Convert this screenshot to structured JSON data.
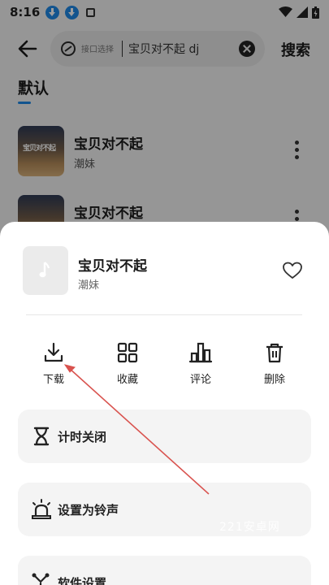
{
  "status_bar": {
    "time": "8:16"
  },
  "header": {
    "source_label": "接口选择",
    "search_query": "宝贝对不起 dj",
    "search_button": "搜索"
  },
  "tab": {
    "label": "默认"
  },
  "songs": [
    {
      "title": "宝贝对不起",
      "artist": "潮妹",
      "cover_text": "宝贝对不起"
    },
    {
      "title": "宝贝对不起",
      "artist": ""
    }
  ],
  "sheet": {
    "song": {
      "title": "宝贝对不起",
      "artist": "潮妹"
    },
    "actions": [
      {
        "label": "下载",
        "icon": "download-icon"
      },
      {
        "label": "收藏",
        "icon": "grid-icon"
      },
      {
        "label": "评论",
        "icon": "bar-chart-icon"
      },
      {
        "label": "删除",
        "icon": "trash-icon"
      }
    ],
    "rows": [
      {
        "label": "计时关闭",
        "icon": "hourglass-icon"
      },
      {
        "label": "设置为铃声",
        "icon": "alarm-bell-icon"
      },
      {
        "label": "软件设置",
        "icon": "settings-icon"
      }
    ]
  },
  "watermark": "221安卓网",
  "colors": {
    "accent": "#1e88e5",
    "annotation_arrow": "#d9534f"
  }
}
